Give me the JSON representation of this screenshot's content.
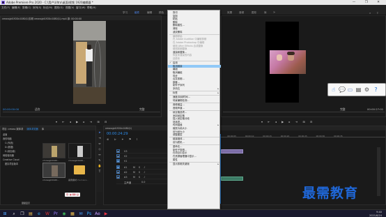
{
  "window": {
    "title": "Adobe Premiere Pro 2020 - C:\\用户\\Ultra\\桌面\\视频 1920编辑器 *",
    "controls": [
      "—",
      "❐",
      "✕"
    ]
  },
  "menubar": [
    "文件(F)",
    "编辑(E)",
    "剪辑(C)",
    "序列(S)",
    "标记(M)",
    "图形(G)",
    "视图(V)",
    "窗口(W)",
    "帮助(H)"
  ],
  "workspace_tabs": [
    {
      "label": "学习",
      "active": false
    },
    {
      "label": "组件",
      "active": true
    },
    {
      "label": "编辑",
      "active": false
    },
    {
      "label": "颜色",
      "active": false
    },
    {
      "label": "效果",
      "active": false
    },
    {
      "label": "音频",
      "active": false
    },
    {
      "label": "图形",
      "active": false
    },
    {
      "label": "库",
      "active": false
    }
  ],
  "source_monitor": {
    "tab_label": "xmossjpt1920x1080(1)剪辑 xmossjpt1920x1080(1).mp4 源: 00:00:00",
    "timecode_left": "00:00:00:00",
    "timecode_right": "00:00:29:29",
    "zoom": "适合",
    "quality": "完整"
  },
  "program_monitor": {
    "timecode_right": "00:00:27:01",
    "quality": "完整"
  },
  "project_panel": {
    "tabs": [
      "项目: xmoss 媒体浏",
      "媒体浏览器",
      "库"
    ],
    "tree": [
      "桌面",
      "我的电脑",
      "C:(系统)",
      "D:(数据)",
      "E:(新加卷)",
      "网络驱动器",
      "Creative Cloud",
      "团队项目版本"
    ],
    "clips": [
      {
        "name": "xmossjpt1920...",
        "duration": ""
      },
      {
        "name": "xmossjpt1920...",
        "duration": ""
      },
      {
        "name": "xmossjpt1920...",
        "duration": ""
      },
      {
        "name": "新建文件夹",
        "duration": ""
      },
      {
        "name": "案例素材",
        "duration": ""
      },
      {
        "name": "Premiere...",
        "duration": ""
      }
    ],
    "footer": "层级显示"
  },
  "timeline": {
    "tab_label": "xmossjpt1920x1080(1)",
    "timecode": "00:00:24:29",
    "tracks_video": [
      "V3",
      "V2",
      "V1"
    ],
    "tracks_audio": [
      "A1",
      "A2",
      "A3"
    ],
    "master": "主声道",
    "master_value": "0.0"
  },
  "context_menu": {
    "items": [
      {
        "label": "剪切",
        "disabled": false
      },
      {
        "label": "复制",
        "disabled": false
      },
      {
        "label": "粘贴",
        "disabled": false
      },
      {
        "label": "删除",
        "disabled": false
      },
      {
        "label": "删除属性...",
        "disabled": false
      },
      {
        "label": "清除",
        "disabled": false
      },
      {
        "label": "波纹删除",
        "disabled": false
      },
      {
        "sep": true
      },
      {
        "label": "编辑原始",
        "disabled": true
      },
      {
        "label": "在 Adobe Audition 中编辑剪辑",
        "disabled": true
      },
      {
        "label": "在 Adobe Photoshop 中编辑",
        "disabled": true
      },
      {
        "label": "使用 After Effects 合成替换",
        "disabled": true
      },
      {
        "label": "使用剪辑替换",
        "disabled": true
      },
      {
        "label": "渲染和替换...",
        "disabled": false
      },
      {
        "label": "恢复未渲染的内容",
        "disabled": true
      },
      {
        "label": "还原未",
        "disabled": true
      },
      {
        "sep": true
      },
      {
        "label": "启用",
        "checked": true,
        "disabled": false
      },
      {
        "label": "取消链接",
        "highlighted": true,
        "disabled": false
      },
      {
        "label": "编组",
        "disabled": false
      },
      {
        "label": "取消编组",
        "disabled": false
      },
      {
        "label": "同步",
        "disabled": false
      },
      {
        "label": "合并剪辑...",
        "disabled": false
      },
      {
        "label": "嵌套...",
        "disabled": false
      },
      {
        "label": "制作子序列",
        "disabled": false
      },
      {
        "label": "多机位",
        "disabled": false,
        "submenu": true
      },
      {
        "sep": true
      },
      {
        "label": "标签",
        "disabled": false,
        "submenu": true
      },
      {
        "sep": true
      },
      {
        "label": "速度/持续时间...",
        "disabled": false
      },
      {
        "label": "场景编辑检测...",
        "disabled": false
      },
      {
        "sep": true
      },
      {
        "label": "音频增益...",
        "disabled": false
      },
      {
        "label": "音频声道...",
        "disabled": false
      },
      {
        "sep": true
      },
      {
        "label": "帧定格选项...",
        "disabled": false
      },
      {
        "label": "添加帧定格",
        "disabled": false
      },
      {
        "label": "插入帧定格分段",
        "disabled": false
      },
      {
        "label": "场选项...",
        "disabled": false
      },
      {
        "label": "时间插值",
        "disabled": false,
        "submenu": true
      },
      {
        "label": "缩放为帧大小",
        "disabled": false
      },
      {
        "label": "设为帧大小",
        "disabled": false
      },
      {
        "label": "调整图层",
        "disabled": false
      },
      {
        "sep": true
      },
      {
        "label": "链接媒体...",
        "disabled": false
      },
      {
        "label": "设为脱机...",
        "disabled": false
      },
      {
        "sep": true
      },
      {
        "label": "重命名...",
        "disabled": false
      },
      {
        "label": "制作子剪辑...",
        "disabled": false
      },
      {
        "label": "在项目中显示",
        "disabled": false
      },
      {
        "label": "在资源管理器中显示...",
        "disabled": false
      },
      {
        "label": "属性",
        "disabled": false
      },
      {
        "sep": true
      },
      {
        "label": "显示剪辑关键帧",
        "disabled": false,
        "submenu": true
      }
    ]
  },
  "watermark": "最需教育",
  "taskbar": {
    "time": "9:40",
    "date": "2021/6/24",
    "icons": [
      "windows-icon",
      "search-icon",
      "taskview-icon",
      "explorer-icon",
      "edge-icon",
      "wps-icon",
      "premiere-icon",
      "chrome-icon",
      "folder-icon",
      "qq-icon",
      "ps-icon",
      "ae-icon",
      "media-icon"
    ]
  },
  "colors": {
    "accent": "#2d8ceb",
    "menu_highlight": "#91c9f7",
    "clip_video": "#7b6ca6",
    "clip_audio": "#3b7a64",
    "watermark": "#1f67d8"
  }
}
